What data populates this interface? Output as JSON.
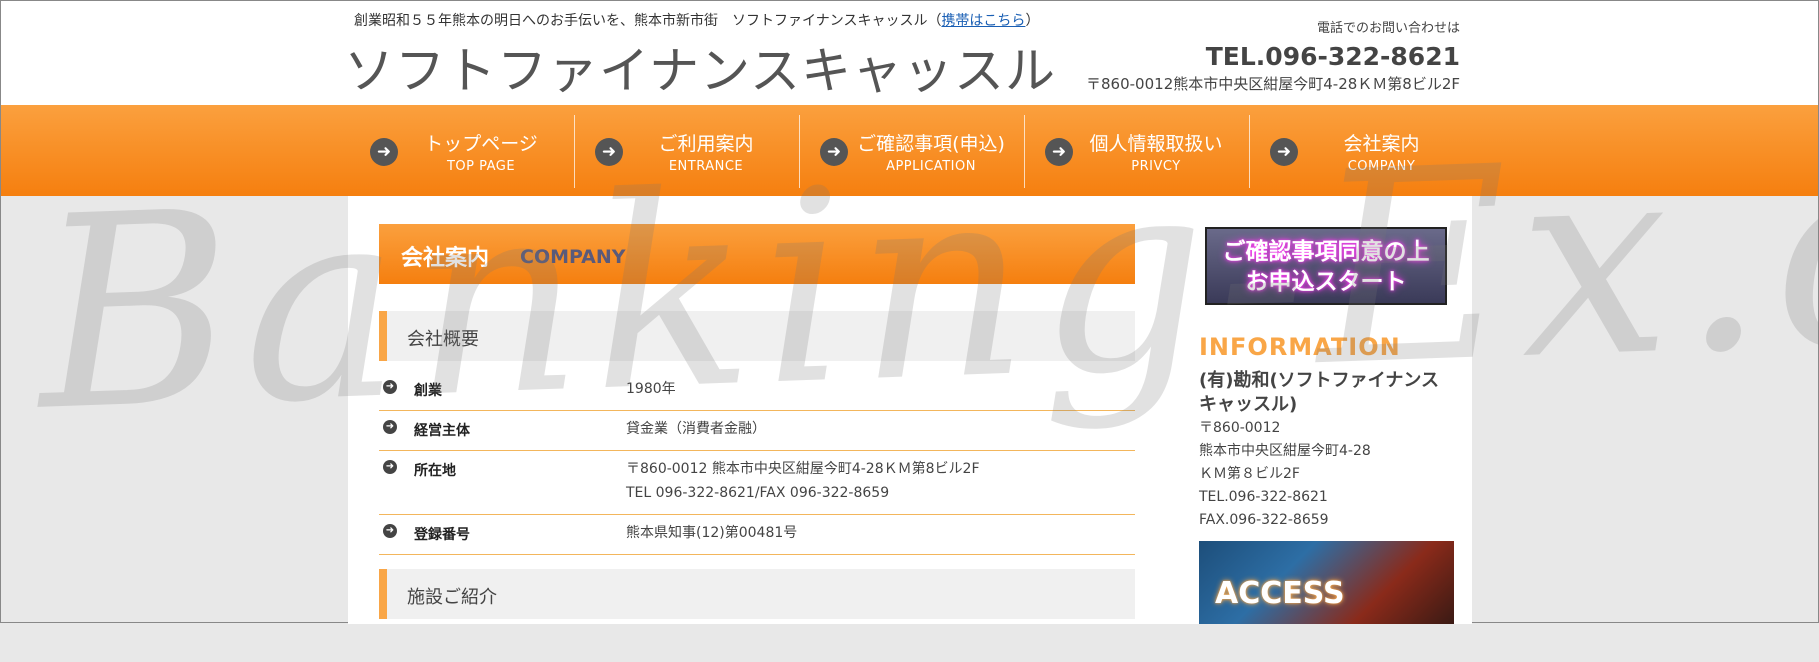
{
  "header": {
    "tagline": "創業昭和５５年熊本の明日へのお手伝いを、熊本市新市街　ソフトファイナンスキャッスル（",
    "mobile_link": "携帯はこちら",
    "tagline_close": "）",
    "logo": "ソフトファイナンスキャッスル",
    "contact_label": "電話でのお問い合わせは",
    "tel": "TEL.096-322-8621",
    "address": "〒860-0012熊本市中央区紺屋今町4-28ＫＭ第8ビル2F"
  },
  "nav": [
    {
      "jp": "トップページ",
      "en": "TOP PAGE"
    },
    {
      "jp": "ご利用案内",
      "en": "ENTRANCE"
    },
    {
      "jp": "ご確認事項(申込)",
      "en": "APPLICATION"
    },
    {
      "jp": "個人情報取扱い",
      "en": "PRIVCY"
    },
    {
      "jp": "会社案内",
      "en": "COMPANY"
    }
  ],
  "watermark": "Banking-Ex.com",
  "page": {
    "title_jp": "会社案内",
    "title_en": "COMPANY",
    "section1": "会社概要",
    "section2": "施設ご紹介"
  },
  "table": [
    {
      "key": "創業",
      "value": "1980年"
    },
    {
      "key": "経営主体",
      "value": "貸金業（消費者金融）"
    },
    {
      "key": "所在地",
      "value": "〒860-0012 熊本市中央区紺屋今町4-28ＫＭ第8ビル2F",
      "value2": "TEL 096-322-8621/FAX 096-322-8659"
    },
    {
      "key": "登録番号",
      "value": "熊本県知事(12)第00481号"
    }
  ],
  "sidebar": {
    "apply_line1": "ご確認事項同意の上",
    "apply_line2": "お申込スタート",
    "info_title": "INFORMATION",
    "company_name": "(有)勘和(ソフトファイナンスキャッスル)",
    "addr1": "〒860-0012",
    "addr2": "熊本市中央区紺屋今町4-28",
    "addr3": "ＫＭ第８ビル2F",
    "tel": "TEL.096-322-8621",
    "fax": "FAX.096-322-8659",
    "access": "ACCESS"
  },
  "colors": {
    "orange_light": "#fba03e",
    "orange_dark": "#f57f0f",
    "info_accent": "#f9a647"
  },
  "icons": {
    "nav_arrow": "arrow-right-circle-icon"
  }
}
